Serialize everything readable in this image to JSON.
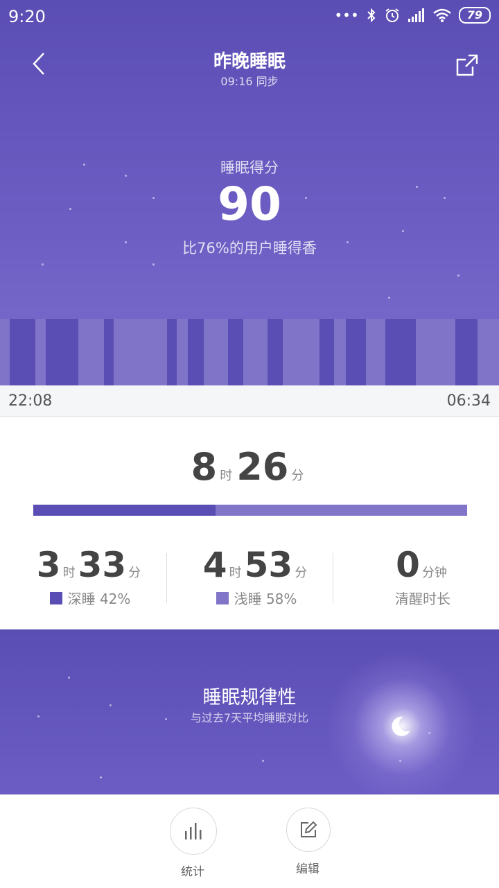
{
  "status_bar": {
    "time": "9:20",
    "battery": "79"
  },
  "header": {
    "title": "昨晚睡眠",
    "sync": "09:16 同步"
  },
  "score": {
    "label": "睡眠得分",
    "value": "90",
    "compare": "比76%的用户睡得香"
  },
  "timeline": {
    "start": "22:08",
    "end": "06:34",
    "colors": {
      "deep": "#5a4db3",
      "light": "#7f74c8"
    }
  },
  "total": {
    "hours": "8",
    "hour_unit": "时",
    "minutes": "26",
    "minute_unit": "分",
    "deep_fraction": 0.42
  },
  "stats": {
    "deep": {
      "hours": "3",
      "hour_unit": "时",
      "minutes": "33",
      "minute_unit": "分",
      "label": "深睡 42%"
    },
    "light": {
      "hours": "4",
      "hour_unit": "时",
      "minutes": "53",
      "minute_unit": "分",
      "label": "浅睡 58%"
    },
    "awake": {
      "value": "0",
      "unit": "分钟",
      "label": "清醒时长"
    }
  },
  "regularity": {
    "title": "睡眠规律性",
    "subtitle": "与过去7天平均睡眠对比"
  },
  "bottom": {
    "stats_label": "统计",
    "edit_label": "编辑"
  }
}
